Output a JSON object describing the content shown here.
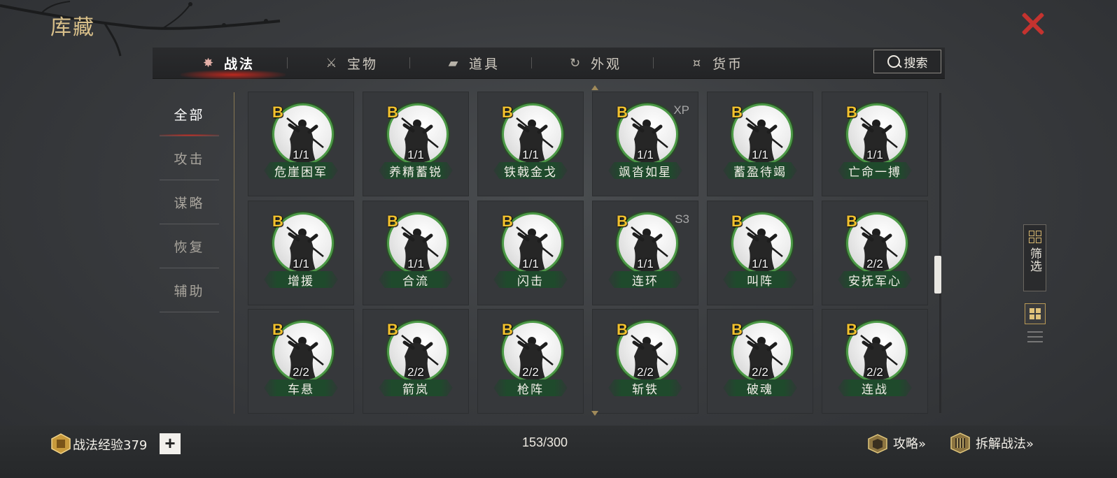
{
  "window": {
    "title": "库藏"
  },
  "tabs": [
    {
      "label": "战法",
      "icon": "tactic-icon",
      "active": true
    },
    {
      "label": "宝物",
      "icon": "treasure-icon",
      "active": false
    },
    {
      "label": "道具",
      "icon": "item-icon",
      "active": false
    },
    {
      "label": "外观",
      "icon": "appearance-icon",
      "active": false
    },
    {
      "label": "货币",
      "icon": "money-bag-icon",
      "active": false
    }
  ],
  "search": {
    "label": "搜索"
  },
  "categories": [
    {
      "label": "全部",
      "active": true
    },
    {
      "label": "攻击",
      "active": false
    },
    {
      "label": "谋略",
      "active": false
    },
    {
      "label": "恢复",
      "active": false
    },
    {
      "label": "辅助",
      "active": false
    }
  ],
  "cards": [
    {
      "grade": "B",
      "count": "1/1",
      "name": "危崖困军",
      "tag": ""
    },
    {
      "grade": "B",
      "count": "1/1",
      "name": "养精蓄锐",
      "tag": ""
    },
    {
      "grade": "B",
      "count": "1/1",
      "name": "铁戟金戈",
      "tag": ""
    },
    {
      "grade": "B",
      "count": "1/1",
      "name": "飒沓如星",
      "tag": "XP"
    },
    {
      "grade": "B",
      "count": "1/1",
      "name": "蓄盈待竭",
      "tag": ""
    },
    {
      "grade": "B",
      "count": "1/1",
      "name": "亡命一搏",
      "tag": ""
    },
    {
      "grade": "B",
      "count": "1/1",
      "name": "增援",
      "tag": ""
    },
    {
      "grade": "B",
      "count": "1/1",
      "name": "合流",
      "tag": ""
    },
    {
      "grade": "B",
      "count": "1/1",
      "name": "闪击",
      "tag": ""
    },
    {
      "grade": "B",
      "count": "1/1",
      "name": "连环",
      "tag": "S3"
    },
    {
      "grade": "B",
      "count": "1/1",
      "name": "叫阵",
      "tag": ""
    },
    {
      "grade": "B",
      "count": "2/2",
      "name": "安抚军心",
      "tag": ""
    },
    {
      "grade": "B",
      "count": "2/2",
      "name": "车悬",
      "tag": ""
    },
    {
      "grade": "B",
      "count": "2/2",
      "name": "箭岚",
      "tag": ""
    },
    {
      "grade": "B",
      "count": "2/2",
      "name": "枪阵",
      "tag": ""
    },
    {
      "grade": "B",
      "count": "2/2",
      "name": "斩铁",
      "tag": ""
    },
    {
      "grade": "B",
      "count": "2/2",
      "name": "破魂",
      "tag": ""
    },
    {
      "grade": "B",
      "count": "2/2",
      "name": "连战",
      "tag": ""
    }
  ],
  "side": {
    "filter_label": "筛选"
  },
  "footer": {
    "exp_label": "战法经验379",
    "plus": "+",
    "capacity": "153/300",
    "guide_label": "攻略»",
    "disassemble_label": "拆解战法»"
  },
  "colors": {
    "accent_red": "#c4332f",
    "grade_gold": "#f2c12e",
    "ring_green": "#4c9a46",
    "title_gold": "#d9c08a"
  }
}
